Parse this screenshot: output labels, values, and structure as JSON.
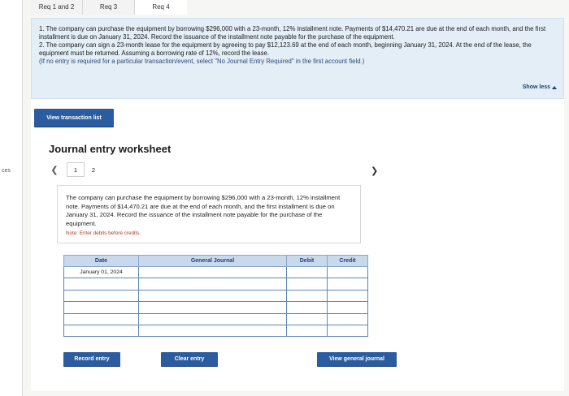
{
  "edge_label": "ces",
  "tabs": [
    {
      "label": "Req 1 and 2",
      "active": false
    },
    {
      "label": "Req 3",
      "active": false
    },
    {
      "label": "Req 4",
      "active": true
    }
  ],
  "requirements": {
    "item1": "1. The company can purchase the equipment by borrowing $296,000 with a 23-month, 12% installment note. Payments of $14,470.21 are due at the end of each month, and the first installment is due on January 31, 2024. Record the issuance of the installment note payable for the purchase of the equipment.",
    "item2": "2. The company can sign a 23-month lease for the equipment by agreeing to pay $12,123.69 at the end of each month, beginning January 31, 2024. At the end of the lease, the equipment must be returned. Assuming a borrowing rate of 12%, record the lease.",
    "note": "(If no entry is required for a particular transaction/event, select \"No Journal Entry Required\" in the first account field.)",
    "show_less": "Show less"
  },
  "buttons": {
    "view_transaction_list": "View transaction list",
    "record_entry": "Record entry",
    "clear_entry": "Clear entry",
    "view_general_journal": "View general journal"
  },
  "worksheet": {
    "title": "Journal entry worksheet",
    "pages": [
      "1",
      "2"
    ],
    "current_page": "1",
    "description": "The company can purchase the equipment by borrowing $296,000 with a 23-month, 12% installment note. Payments of $14,470.21 are due at the end of each month, and the first installment is due on January 31, 2024. Record the issuance of the installment note payable for the purchase of the equipment.",
    "note": "Note: Enter debits before credits."
  },
  "table": {
    "headers": {
      "date": "Date",
      "account": "General Journal",
      "debit": "Debit",
      "credit": "Credit"
    },
    "rows": [
      {
        "date": "January 01, 2024",
        "account": "",
        "debit": "",
        "credit": ""
      },
      {
        "date": "",
        "account": "",
        "debit": "",
        "credit": ""
      },
      {
        "date": "",
        "account": "",
        "debit": "",
        "credit": ""
      },
      {
        "date": "",
        "account": "",
        "debit": "",
        "credit": ""
      },
      {
        "date": "",
        "account": "",
        "debit": "",
        "credit": ""
      },
      {
        "date": "",
        "account": "",
        "debit": "",
        "credit": ""
      }
    ]
  },
  "colors": {
    "button_blue": "#2b5ca0",
    "requirements_bg": "#e3eef7",
    "table_header_bg": "#c8d9ee",
    "note_red": "#b03a2e"
  }
}
